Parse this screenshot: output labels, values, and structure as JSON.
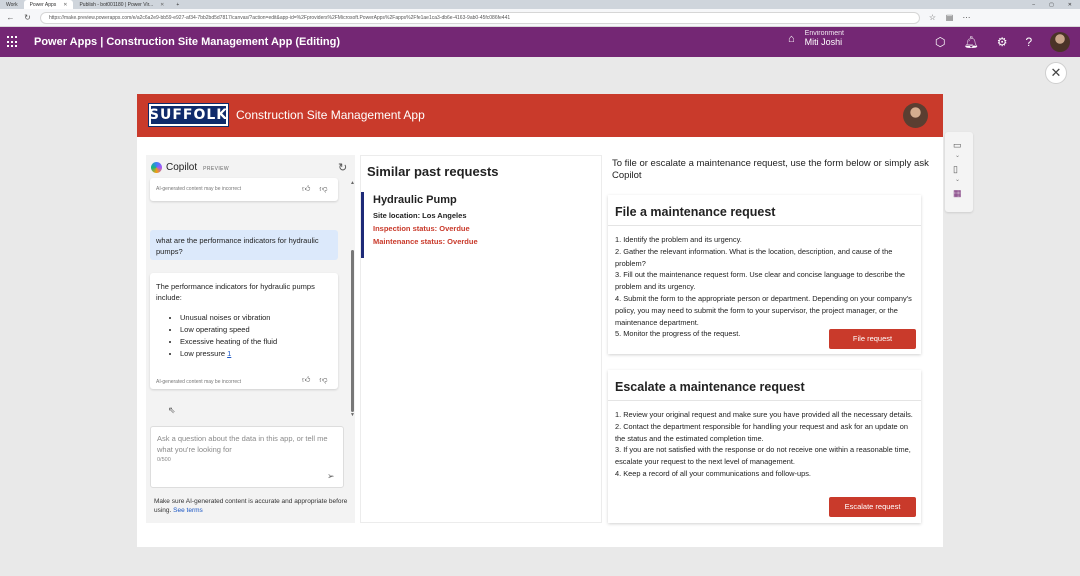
{
  "browser": {
    "tabs": [
      {
        "label": "Work",
        "active": false
      },
      {
        "label": "Power Apps",
        "active": true
      },
      {
        "label": "Publish - bot001180 | Power Vir...",
        "active": false
      }
    ],
    "url": "https://make.preview.powerapps.com/e/a2c6a2e9-bb59-e927-af34-7bb2bd5d7817/canvas/?action=edit&app-id=%2Fproviders%2FMicrosoft.PowerApps%2Fapps%2Ffe1ae1ca3-db6e-4163-9ab0-45fc086fe441"
  },
  "header": {
    "title": "Power Apps  |  Construction Site Management App (Editing)",
    "environment_label": "Environment",
    "environment_name": "Miti Joshi"
  },
  "app": {
    "logo_text": "SUFFOLK",
    "title": "Construction Site Management App",
    "brand_color": "#c93a2b"
  },
  "copilot": {
    "name": "Copilot",
    "badge": "PREVIEW",
    "ai_note": "AI-generated content may be incorrect",
    "user_question": "what are the performance indicators for hydraulic pumps?",
    "answer_intro": "The performance indicators for hydraulic pumps include:",
    "answer_items": [
      "Unusual noises or vibration",
      "Low operating speed",
      "Excessive heating of the fluid",
      "Low pressure"
    ],
    "citation": "1",
    "input_placeholder": "Ask a question about the data in this app, or tell me what you're looking for",
    "char_count": "0/500",
    "footer_text": "Make sure AI-generated content is accurate and appropriate before using.",
    "footer_link": "See terms"
  },
  "similar": {
    "title": "Similar past requests",
    "items": [
      {
        "name": "Hydraulic Pump",
        "location": "Site location: Los Angeles",
        "inspection": "Inspection status: Overdue",
        "maintenance": "Maintenance status: Overdue"
      }
    ]
  },
  "intro": "To file or escalate a maintenance request, use the form below or simply ask Copilot",
  "file_request": {
    "title": "File a maintenance request",
    "steps": [
      "1. Identify the problem and its urgency.",
      "2. Gather the relevant information. What is the location, description, and cause of the problem?",
      "3. Fill out the maintenance request form. Use clear and concise language to describe the problem and its urgency.",
      "4. Submit the form to the appropriate person or department. Depending on your company's policy, you may need to submit the form to your supervisor, the project manager, or the maintenance department.",
      "5. Monitor the progress of the request."
    ],
    "button": "File request"
  },
  "escalate_request": {
    "title": "Escalate a maintenance request",
    "steps": [
      "1. Review your original request and make sure you have provided all the necessary details.",
      "2. Contact the department responsible for handling your request and ask for an update on the status and the estimated completion time.",
      "3. If you are not satisfied with the response or do not receive one within a reasonable time, escalate your request to the next level of management.",
      "4. Keep a record of all your communications and follow-ups."
    ],
    "button": "Escalate request"
  }
}
